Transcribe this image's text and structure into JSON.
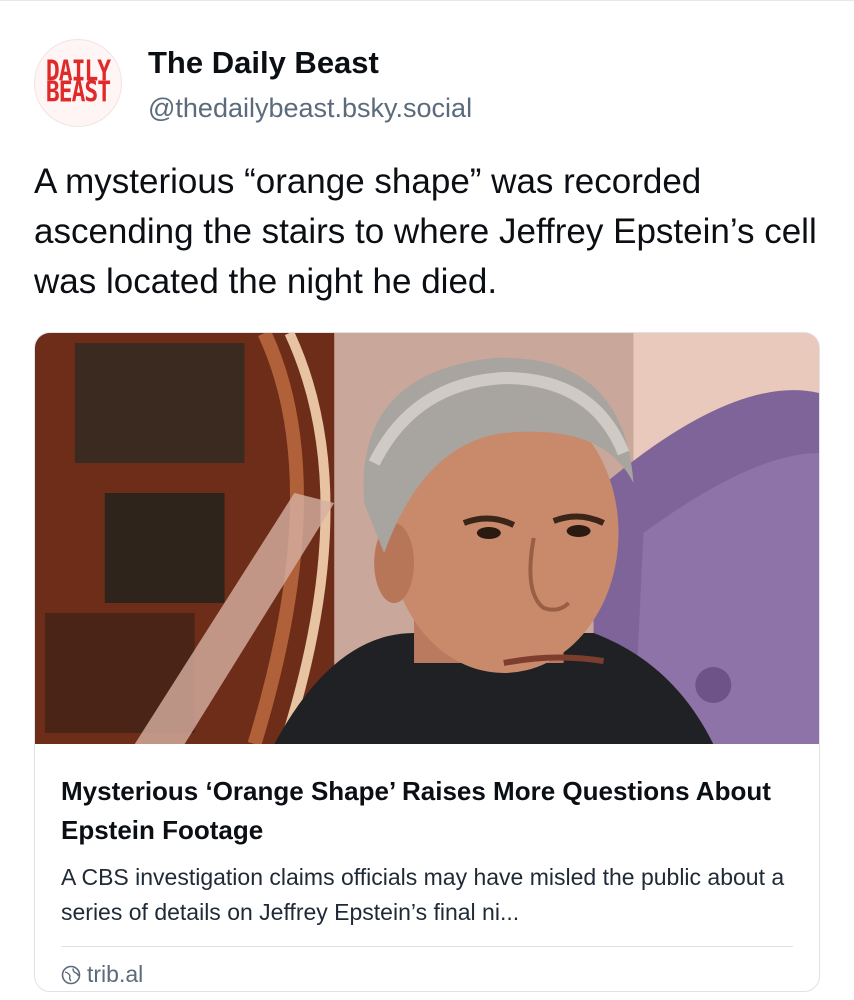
{
  "author": {
    "avatar_line1": "DAILY",
    "avatar_line2": "BEAST",
    "display_name": "The Daily Beast",
    "handle": "@thedailybeast.bsky.social"
  },
  "post": {
    "text": "A mysterious “orange shape” was recorded ascending the stairs to where Jeffrey Epstein’s cell was located the night he died."
  },
  "link_card": {
    "title": "Mysterious ‘Orange Shape’ Raises More Questions About Epstein Footage",
    "description": "A CBS investigation claims officials may have misled the public about a series of details on Jeffrey Epstein’s final ni...",
    "domain": "trib.al",
    "domain_icon": "globe-icon"
  },
  "colors": {
    "avatar_red": "#e02a2a",
    "handle_gray": "#5b6b7b",
    "border": "#dfe3e8"
  }
}
